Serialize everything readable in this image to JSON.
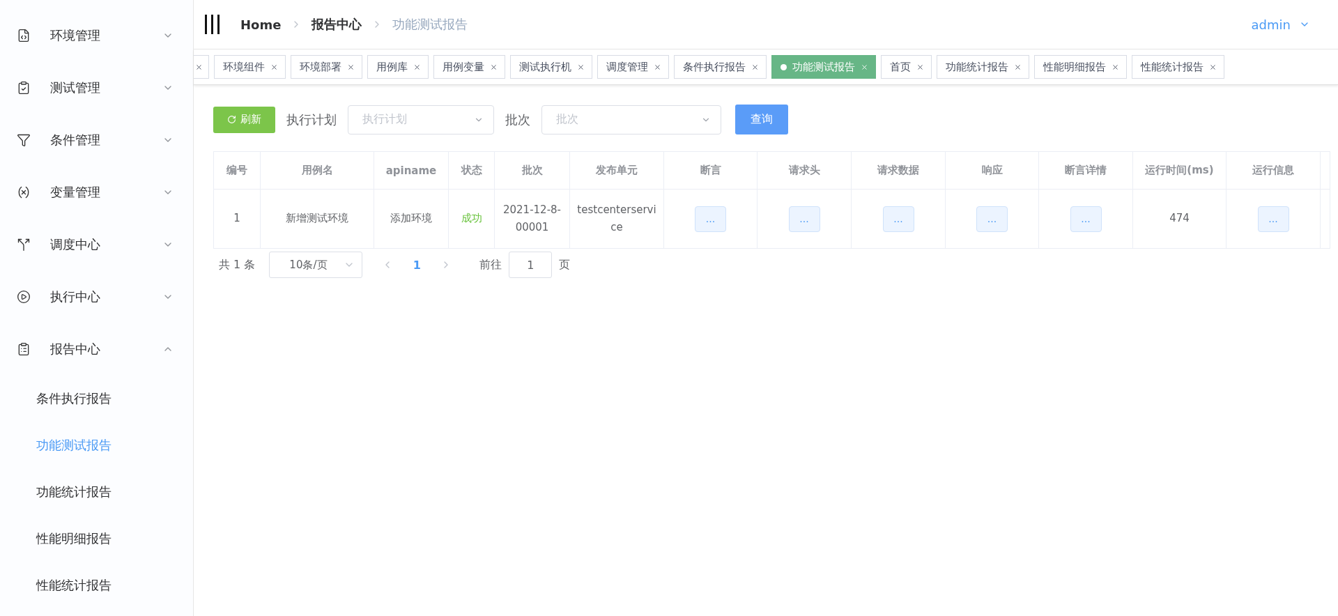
{
  "sidebar": {
    "items": [
      {
        "label": "环境管理",
        "expanded": false
      },
      {
        "label": "测试管理",
        "expanded": false
      },
      {
        "label": "条件管理",
        "expanded": false
      },
      {
        "label": "变量管理",
        "expanded": false
      },
      {
        "label": "调度中心",
        "expanded": false
      },
      {
        "label": "执行中心",
        "expanded": false
      },
      {
        "label": "报告中心",
        "expanded": true,
        "children": [
          {
            "label": "条件执行报告",
            "selected": false
          },
          {
            "label": "功能测试报告",
            "selected": true
          },
          {
            "label": "功能统计报告",
            "selected": false
          },
          {
            "label": "性能明细报告",
            "selected": false
          },
          {
            "label": "性能统计报告",
            "selected": false
          }
        ]
      }
    ]
  },
  "header": {
    "breadcrumb": [
      {
        "label": "Home",
        "current": false
      },
      {
        "label": "报告中心",
        "current": false
      },
      {
        "label": "功能测试报告",
        "current": true
      }
    ],
    "user": "admin"
  },
  "tabs": [
    {
      "label": "环境组件",
      "selected": false
    },
    {
      "label": "环境部署",
      "selected": false
    },
    {
      "label": "用例库",
      "selected": false
    },
    {
      "label": "用例变量",
      "selected": false
    },
    {
      "label": "测试执行机",
      "selected": false
    },
    {
      "label": "调度管理",
      "selected": false
    },
    {
      "label": "条件执行报告",
      "selected": false
    },
    {
      "label": "功能测试报告",
      "selected": true
    },
    {
      "label": "首页",
      "selected": false
    },
    {
      "label": "功能统计报告",
      "selected": false
    },
    {
      "label": "性能明细报告",
      "selected": false
    },
    {
      "label": "性能统计报告",
      "selected": false
    }
  ],
  "toolbar": {
    "refresh": "刷新",
    "plan_label": "执行计划",
    "plan_placeholder": "执行计划",
    "batch_label": "批次",
    "batch_placeholder": "批次",
    "query": "查询"
  },
  "table": {
    "columns": [
      "编号",
      "用例名",
      "apiname",
      "状态",
      "批次",
      "发布单元",
      "断言",
      "请求头",
      "请求数据",
      "响应",
      "断言详情",
      "运行时间(ms)",
      "运行信息"
    ],
    "rows": [
      {
        "cells": [
          {
            "kind": "text",
            "text": "1"
          },
          {
            "kind": "text",
            "text": "新增测试环境"
          },
          {
            "kind": "text",
            "text": "添加环境"
          },
          {
            "kind": "status",
            "text": "成功",
            "color": "#67c23a"
          },
          {
            "kind": "text",
            "text": "2021-12-8-00001"
          },
          {
            "kind": "text",
            "text": "testcenterservice"
          },
          {
            "kind": "button",
            "text": "..."
          },
          {
            "kind": "button",
            "text": "..."
          },
          {
            "kind": "button",
            "text": "..."
          },
          {
            "kind": "button",
            "text": "..."
          },
          {
            "kind": "button",
            "text": "..."
          },
          {
            "kind": "text",
            "text": "474"
          },
          {
            "kind": "button",
            "text": "..."
          }
        ]
      }
    ]
  },
  "pagination": {
    "total": "共 1 条",
    "page_size": "10条/页",
    "pages": [
      {
        "label": "1",
        "selected": true
      }
    ],
    "goto_label": "前往",
    "goto_value": "1",
    "page_suffix": "页"
  }
}
